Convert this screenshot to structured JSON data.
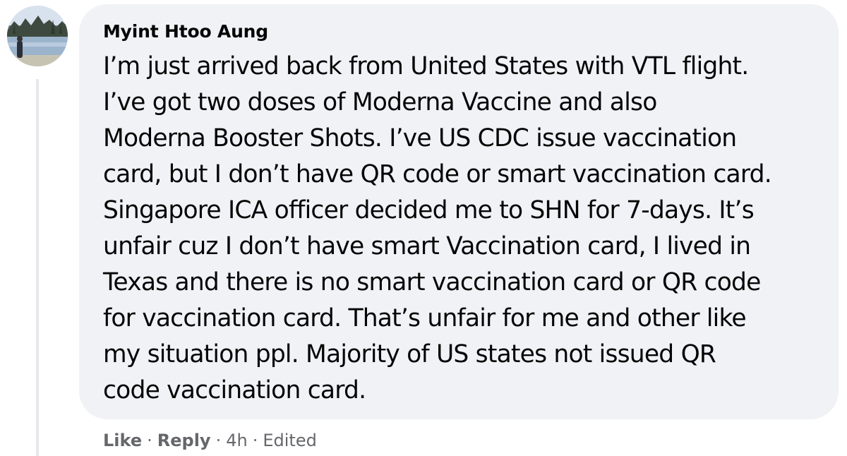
{
  "comment": {
    "author": "Myint Htoo Aung",
    "text_lines": [
      "I’m just arrived back from United States with VTL flight.",
      "I’ve got two doses of Moderna Vaccine and also",
      "Moderna Booster Shots. I’ve US CDC issue vaccination",
      "card, but I don’t have QR code or smart vaccination card.",
      "Singapore ICA officer decided me to SHN for 7-days. It’s",
      "unfair cuz I don’t have smart Vaccination card, I lived in",
      "Texas and there is no smart vaccination card or QR code",
      "for vaccination card. That’s unfair for me and other like",
      "my situation ppl. Majority of US states not issued QR",
      "code vaccination card."
    ],
    "actions": {
      "like_label": "Like",
      "reply_label": "Reply",
      "separator": "·",
      "timestamp": "4h",
      "edited_label": "Edited"
    }
  },
  "colors": {
    "bubble_background": "#f0f2f5",
    "primary_text": "#050505",
    "secondary_text": "#65676b",
    "thread_line": "#e6e8eb"
  },
  "icons": {
    "avatar": "profile-photo-lake-landscape"
  }
}
